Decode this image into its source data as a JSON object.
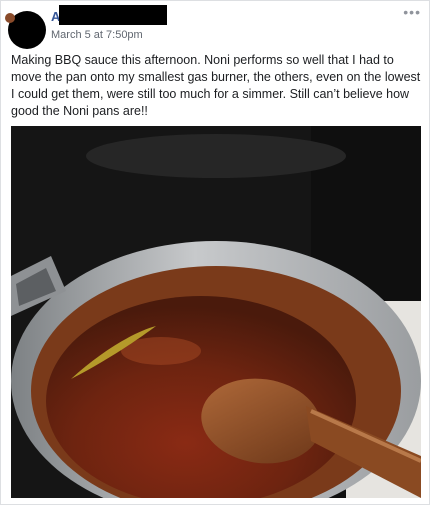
{
  "post": {
    "author_initial": "A",
    "timestamp": "March 5 at 7:50pm",
    "more_icon": "more-horizontal-icon",
    "text": "Making BBQ sauce this afternoon. Noni performs so well that I had to move the pan onto my smallest gas burner, the others, even on the lowest I could get them, were still too much for a simmer. Still can’t believe how good the Noni pans are!!"
  },
  "colors": {
    "link": "#385898",
    "meta": "#616770",
    "text": "#1c1e21",
    "border": "#dddfe2"
  }
}
